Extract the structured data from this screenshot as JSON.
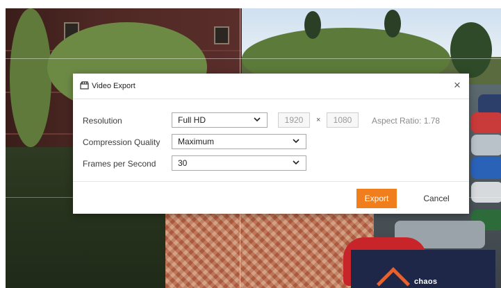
{
  "dialog": {
    "title": "Video Export",
    "close_glyph": "×",
    "icon": "video-export-icon",
    "resolution": {
      "label": "Resolution",
      "value": "Full HD",
      "width": "1920",
      "separator": "×",
      "height": "1080",
      "aspect_ratio": "Aspect Ratio: 1.78"
    },
    "compression": {
      "label": "Compression Quality",
      "value": "Maximum"
    },
    "fps": {
      "label": "Frames per Second",
      "value": "30"
    },
    "export_label": "Export",
    "cancel_label": "Cancel"
  },
  "brand": {
    "text": "chaos"
  },
  "colors": {
    "accent": "#f07e1c",
    "brand_panel": "#1f2748",
    "brand_logo": "#e8602c"
  }
}
